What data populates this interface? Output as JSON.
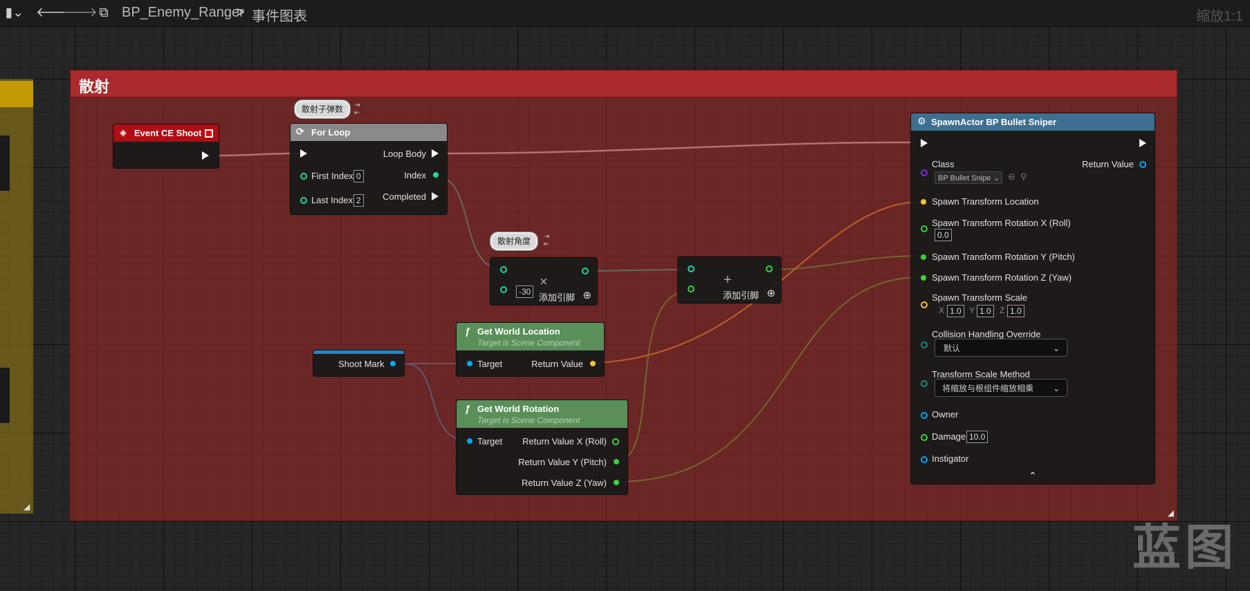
{
  "toolbar": {
    "breadcrumb_blueprint": "BP_Enemy_Ranger",
    "breadcrumb_graph": "事件图表",
    "zoom_label": "缩放1:1"
  },
  "comment": {
    "title": "散射"
  },
  "nodes": {
    "event": {
      "title": "Event CE Shoot"
    },
    "forloop": {
      "bubble": "散射子弹数",
      "title": "For Loop",
      "loop_body": "Loop Body",
      "first_index_label": "First Index",
      "first_index_value": "0",
      "last_index_label": "Last Index",
      "last_index_value": "2",
      "index_label": "Index",
      "completed_label": "Completed"
    },
    "multiply": {
      "bubble": "散射角度",
      "operand_value": "-30",
      "add_pin_label": "添加引脚",
      "operator": "×"
    },
    "add": {
      "add_pin_label": "添加引脚",
      "operator": "+"
    },
    "shootmark": {
      "label": "Shoot Mark"
    },
    "getworldlocation": {
      "title": "Get World Location",
      "subtitle": "Target is Scene Component",
      "target": "Target",
      "return_value": "Return Value"
    },
    "getworldrotation": {
      "title": "Get World Rotation",
      "subtitle": "Target is Scene Component",
      "target": "Target",
      "rx": "Return Value X (Roll)",
      "ry": "Return Value Y (Pitch)",
      "rz": "Return Value Z (Yaw)"
    },
    "spawn": {
      "title": "SpawnActor BP Bullet Sniper",
      "class_label": "Class",
      "class_value": "BP Bullet Snipe",
      "return_value": "Return Value",
      "loc": "Spawn Transform Location",
      "rot_x": "Spawn Transform Rotation X (Roll)",
      "rot_x_value": "0.0",
      "rot_y": "Spawn Transform Rotation Y (Pitch)",
      "rot_z": "Spawn Transform Rotation Z (Yaw)",
      "scale": "Spawn Transform Scale",
      "scale_x_label": "X",
      "scale_x": "1.0",
      "scale_y_label": "Y",
      "scale_y": "1.0",
      "scale_z_label": "Z",
      "scale_z": "1.0",
      "collision": "Collision Handling Override",
      "collision_value": "默认",
      "scale_method": "Transform Scale Method",
      "scale_method_value": "将缩放与根组件缩放相乘",
      "owner": "Owner",
      "damage": "Damage",
      "damage_value": "10.0",
      "instigator": "Instigator"
    }
  },
  "watermark": "蓝图",
  "colors": {
    "exec": "#ffffff",
    "integer": "#1fd6a6",
    "float": "#39d33b",
    "vector": "#f6c12a",
    "object": "#00a8f3",
    "class": "#7a2bd8",
    "comment_header": "#aa2a2e",
    "function_header": "#5a8f5a",
    "event_header": "#b00d14",
    "spawn_header": "#3d6f91"
  }
}
